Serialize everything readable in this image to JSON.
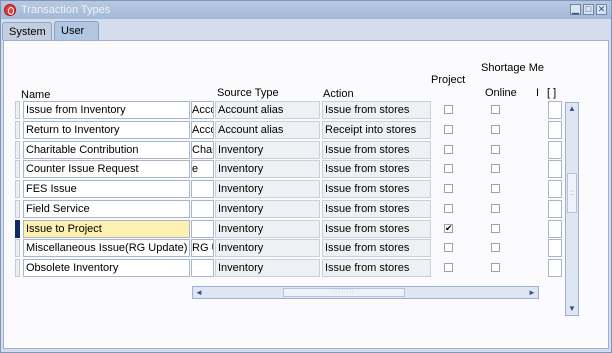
{
  "window": {
    "title": "Transaction Types",
    "minimize": "▁",
    "maximize": "□",
    "close": "✕"
  },
  "tabs": [
    {
      "label": "System"
    },
    {
      "label": "User"
    }
  ],
  "headers": {
    "name": "Name",
    "source_type": "Source Type",
    "action": "Action",
    "project": "Project",
    "shortage": "Shortage Me",
    "online": "Online",
    "cut": "I",
    "flex": "[ ]"
  },
  "rows": [
    {
      "name": "Issue from Inventory",
      "extra": "Acco",
      "source": "Account alias",
      "action": "Issue from stores",
      "project": false
    },
    {
      "name": "Return to Inventory",
      "extra": "Accou",
      "source": "Account alias",
      "action": "Receipt into stores",
      "project": false
    },
    {
      "name": "Charitable Contribution",
      "extra": "Chari",
      "source": "Inventory",
      "action": "Issue from stores",
      "project": false
    },
    {
      "name": "Counter Issue Request",
      "extra": "e",
      "source": "Inventory",
      "action": "Issue from stores",
      "project": false
    },
    {
      "name": "FES Issue",
      "extra": "",
      "source": "Inventory",
      "action": "Issue from stores",
      "project": false
    },
    {
      "name": "Field Service",
      "extra": "",
      "source": "Inventory",
      "action": "Issue from stores",
      "project": false
    },
    {
      "name": "Issue to Project",
      "extra": "",
      "source": "Inventory",
      "action": "Issue from stores",
      "project": true
    },
    {
      "name": "Miscellaneous Issue(RG Update)",
      "extra": "RG U",
      "source": "Inventory",
      "action": "Issue from stores",
      "project": false
    },
    {
      "name": "Obsolete Inventory",
      "extra": "",
      "source": "Inventory",
      "action": "Issue from stores",
      "project": false
    }
  ],
  "current_row_index": 6,
  "checkmark": "✔",
  "scroll": {
    "up": "▲",
    "down": "▼",
    "left": "◄",
    "right": "►",
    "grip": "::::::::",
    "vgrip": "::"
  }
}
